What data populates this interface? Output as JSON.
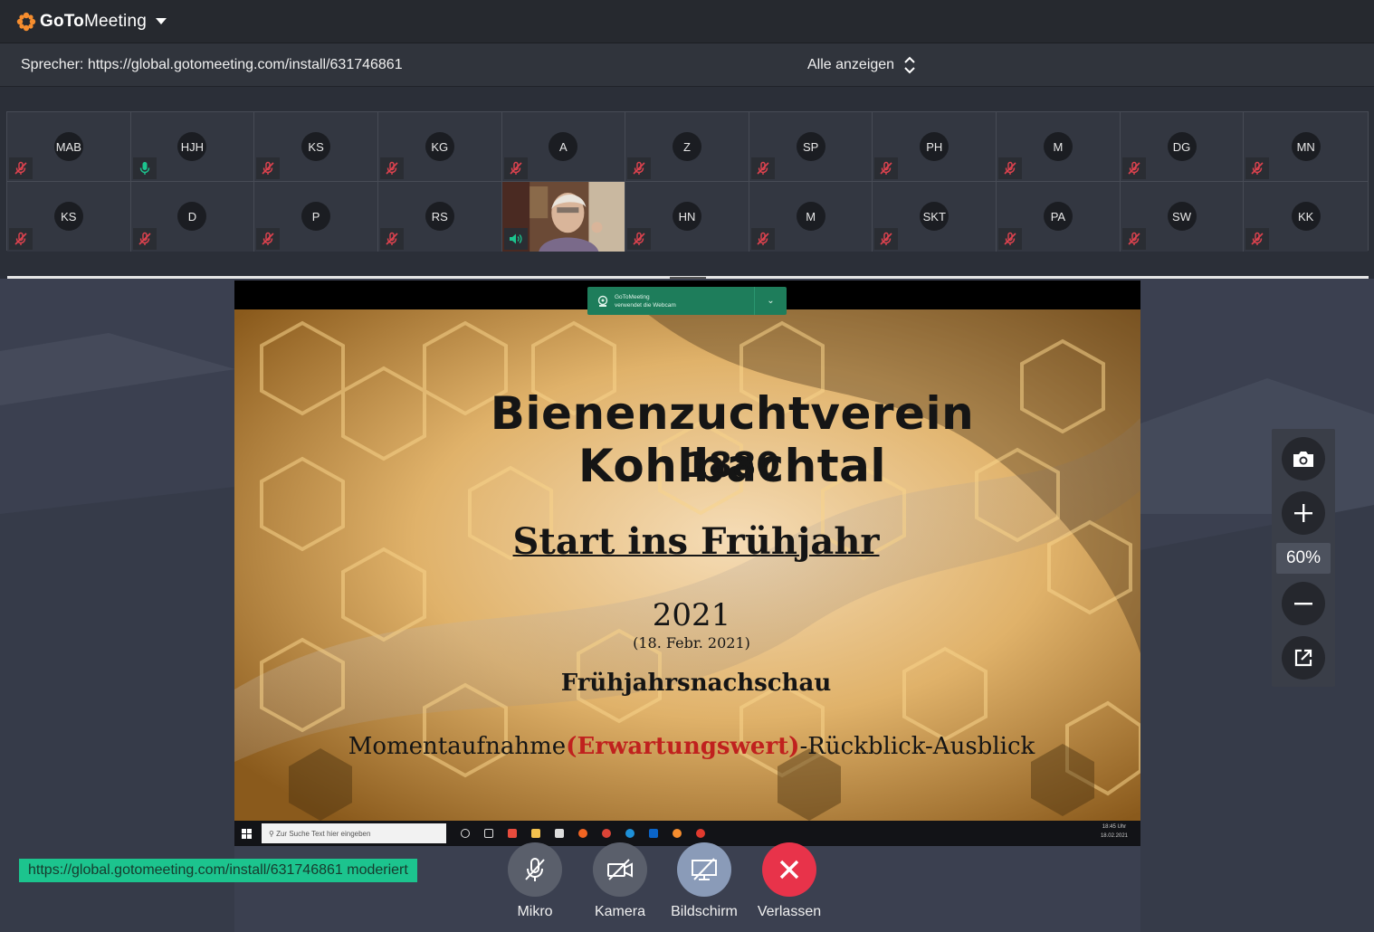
{
  "app": {
    "brand_bold": "GoTo",
    "brand_light": "Meeting",
    "accent": "#f68d2e"
  },
  "speaker_bar": {
    "speaker_text": "Sprecher: https://global.gotomeeting.com/install/631746861",
    "show_all_label": "Alle anzeigen"
  },
  "participants": [
    {
      "initials": "MAB",
      "mic": "muted"
    },
    {
      "initials": "HJH",
      "mic": "active"
    },
    {
      "initials": "KS",
      "mic": "muted"
    },
    {
      "initials": "KG",
      "mic": "muted"
    },
    {
      "initials": "A",
      "mic": "muted"
    },
    {
      "initials": "Z",
      "mic": "muted"
    },
    {
      "initials": "SP",
      "mic": "muted"
    },
    {
      "initials": "PH",
      "mic": "muted"
    },
    {
      "initials": "M",
      "mic": "muted"
    },
    {
      "initials": "DG",
      "mic": "muted"
    },
    {
      "initials": "MN",
      "mic": "muted"
    },
    {
      "initials": "KS",
      "mic": "muted"
    },
    {
      "initials": "D",
      "mic": "muted"
    },
    {
      "initials": "P",
      "mic": "muted"
    },
    {
      "initials": "RS",
      "mic": "muted"
    },
    {
      "initials": "",
      "mic": "speaking",
      "video": true
    },
    {
      "initials": "HN",
      "mic": "muted"
    },
    {
      "initials": "M",
      "mic": "muted"
    },
    {
      "initials": "SKT",
      "mic": "muted"
    },
    {
      "initials": "PA",
      "mic": "muted"
    },
    {
      "initials": "SW",
      "mic": "muted"
    },
    {
      "initials": "KK",
      "mic": "muted"
    }
  ],
  "slide": {
    "title": "Bienenzuchtverein Kohlbachtal",
    "founded": "1880",
    "subtitle": "Start ins Frühjahr",
    "year": "2021",
    "date": "(18. Febr. 2021)",
    "topic": "Frühjahrsnachschau",
    "moment_a": "Momentaufnahme",
    "moment_red": "(Erwartungswert)",
    "moment_b": "-Rückblick-Ausblick"
  },
  "webcam_toast": {
    "line1": "GoToMeeting",
    "line2": "verwendet die Webcam"
  },
  "shared_taskbar": {
    "search_placeholder": "Zur Suche Text hier eingeben",
    "time": "18:45 Uhr",
    "date": "18.02.2021"
  },
  "zoom": {
    "level": "60%"
  },
  "organizer_badge": "https://global.gotomeeting.com/install/631746861 moderiert",
  "controls": {
    "mic_label": "Mikro",
    "camera_label": "Kamera",
    "screen_label": "Bildschirm",
    "leave_label": "Verlassen"
  },
  "colors": {
    "muted_red": "#e0434f",
    "active_green": "#1cc48e",
    "leave_red": "#e8334a",
    "screen_blue": "#8a9bb8"
  }
}
